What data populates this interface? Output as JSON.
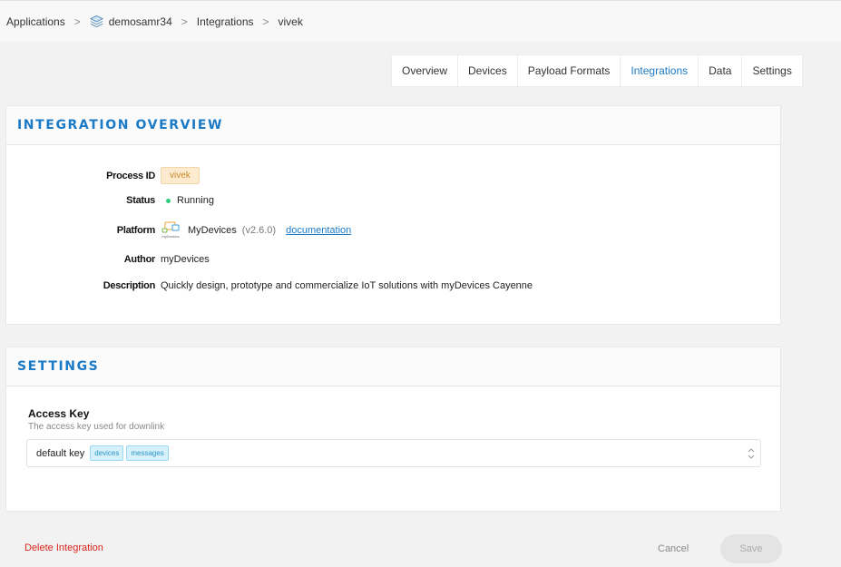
{
  "breadcrumb": {
    "applications": "Applications",
    "app_icon": "layers-icon",
    "app": "demosamr34",
    "integrations": "Integrations",
    "current": "vivek",
    "separator": ">"
  },
  "tabs": [
    {
      "label": "Overview"
    },
    {
      "label": "Devices"
    },
    {
      "label": "Payload Formats"
    },
    {
      "label": "Integrations",
      "active": true
    },
    {
      "label": "Data"
    },
    {
      "label": "Settings"
    }
  ],
  "overview": {
    "title": "INTEGRATION OVERVIEW",
    "process_id": {
      "label": "Process ID",
      "value": "vivek"
    },
    "status": {
      "label": "Status",
      "value": "Running",
      "color": "#2ecf7a"
    },
    "platform": {
      "label": "Platform",
      "logo_text": "myDevices",
      "name": "MyDevices",
      "version": "(v2.6.0)",
      "link": "documentation"
    },
    "author": {
      "label": "Author",
      "value": "myDevices"
    },
    "description": {
      "label": "Description",
      "value": "Quickly design, prototype and commercialize IoT solutions with myDevices Cayenne"
    }
  },
  "settings": {
    "title": "SETTINGS",
    "access_key": {
      "label": "Access Key",
      "description": "The access key used for downlink",
      "value": "default key",
      "rights": [
        "devices",
        "messages"
      ]
    }
  },
  "actions": {
    "delete": "Delete Integration",
    "cancel": "Cancel",
    "save": "Save"
  },
  "colors": {
    "accent": "#1b7ac6",
    "danger": "#d9241c",
    "badge_bg": "#fdebcf",
    "tag_bg": "#d6f1fb"
  }
}
